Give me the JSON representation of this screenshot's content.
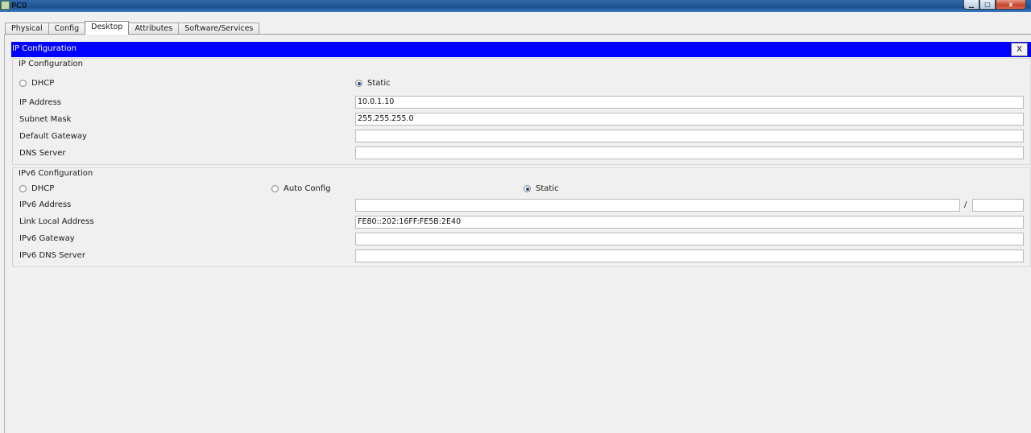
{
  "window": {
    "title": "PC0",
    "controls": {
      "minimize": "▁",
      "maximize": "□",
      "close": "x"
    }
  },
  "tabs": [
    {
      "label": "Physical"
    },
    {
      "label": "Config"
    },
    {
      "label": "Desktop",
      "active": true
    },
    {
      "label": "Attributes"
    },
    {
      "label": "Software/Services"
    }
  ],
  "ip_config": {
    "header": "IP Configuration",
    "close_label": "X",
    "group_title": "IP Configuration",
    "dhcp_label": "DHCP",
    "static_label": "Static",
    "selected_mode": "Static",
    "ip_address": {
      "label": "IP Address",
      "value": "10.0.1.10"
    },
    "subnet_mask": {
      "label": "Subnet Mask",
      "value": "255.255.255.0"
    },
    "default_gateway": {
      "label": "Default Gateway",
      "value": ""
    },
    "dns_server": {
      "label": "DNS Server",
      "value": ""
    }
  },
  "ipv6_config": {
    "group_title": "IPv6 Configuration",
    "dhcp_label": "DHCP",
    "auto_config_label": "Auto Config",
    "static_label": "Static",
    "selected_mode": "Static",
    "ipv6_address": {
      "label": "IPv6 Address",
      "value": "",
      "prefix_separator": "/",
      "prefix_value": ""
    },
    "link_local_address": {
      "label": "Link Local Address",
      "value": "FE80::202:16FF:FE5B:2E40"
    },
    "ipv6_gateway": {
      "label": "IPv6 Gateway",
      "value": ""
    },
    "ipv6_dns_server": {
      "label": "IPv6 DNS Server",
      "value": ""
    }
  },
  "colors": {
    "header_blue": "#0000ff",
    "window_bg": "#f0f0f0"
  }
}
